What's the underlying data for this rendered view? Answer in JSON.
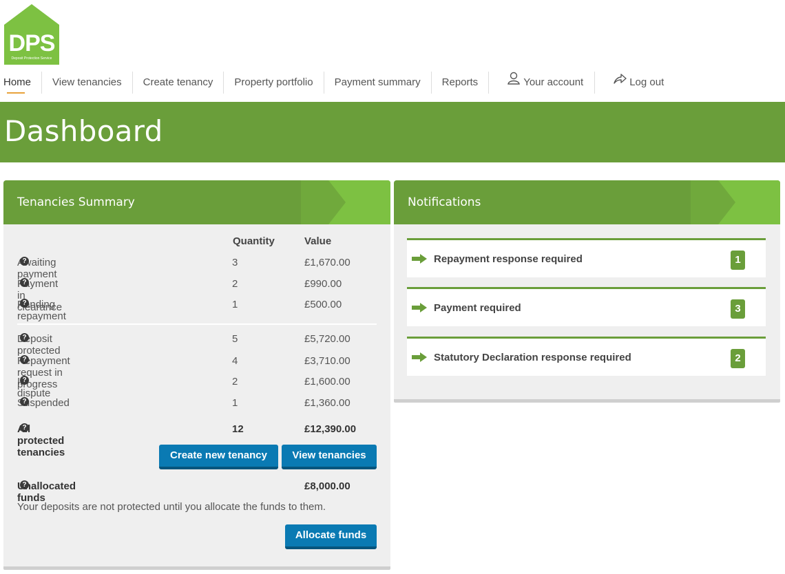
{
  "logo": {
    "text": "DPS",
    "subtitle": "Deposit Protection Service"
  },
  "nav": [
    {
      "label": "Home"
    },
    {
      "label": "View tenancies"
    },
    {
      "label": "Create tenancy"
    },
    {
      "label": "Property portfolio"
    },
    {
      "label": "Payment summary"
    },
    {
      "label": "Reports"
    },
    {
      "label": "Your account",
      "icon": "user-icon"
    },
    {
      "label": "Log out",
      "icon": "share-arrow-icon"
    }
  ],
  "page_title": "Dashboard",
  "summary": {
    "title": "Tenancies Summary",
    "col_quantity": "Quantity",
    "col_value": "Value",
    "rows": [
      {
        "label": "Awaiting payment",
        "quantity": "3",
        "value": "£1,670.00"
      },
      {
        "label": "Payment in clearance",
        "quantity": "2",
        "value": "£990.00"
      },
      {
        "label": "Pending repayment",
        "quantity": "1",
        "value": "£500.00"
      },
      {
        "label": "Deposit protected",
        "quantity": "5",
        "value": "£5,720.00"
      },
      {
        "label": "Repayment request in progress",
        "quantity": "4",
        "value": "£3,710.00"
      },
      {
        "label": "In dispute",
        "quantity": "2",
        "value": "£1,600.00"
      },
      {
        "label": "Suspended",
        "quantity": "1",
        "value": "£1,360.00"
      }
    ],
    "total": {
      "label": "All protected tenancies",
      "quantity": "12",
      "value": "£12,390.00"
    },
    "create_button": "Create new tenancy",
    "view_button": "View tenancies",
    "unallocated": {
      "label": "Unallocated funds",
      "value": "£8,000.00"
    },
    "note": "Your deposits are not protected until you allocate the funds to them.",
    "allocate_button": "Allocate funds",
    "help_glyph": "?"
  },
  "notifications": {
    "title": "Notifications",
    "items": [
      {
        "label": "Repayment response required",
        "count": "1"
      },
      {
        "label": "Payment required",
        "count": "3"
      },
      {
        "label": "Statutory Declaration response required",
        "count": "2"
      }
    ]
  },
  "colors": {
    "brand_green": "#6a9e3a",
    "light_green": "#7dc142",
    "button_blue": "#0a7ab3",
    "accent_underline": "#e8a23a"
  }
}
